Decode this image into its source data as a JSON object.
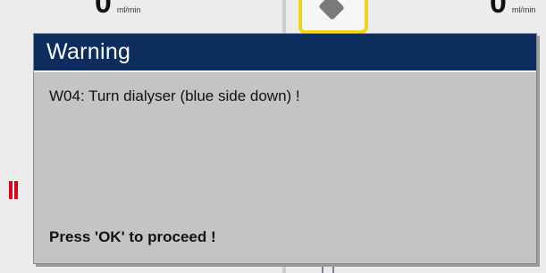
{
  "background": {
    "left_flow": {
      "value": "0",
      "unit": "ml/min"
    },
    "right_flow": {
      "value": "0",
      "unit": "ml/min"
    }
  },
  "dialog": {
    "title": "Warning",
    "message": "W04: Turn dialyser (blue side down) !",
    "instruction": "Press 'OK' to proceed !"
  },
  "colors": {
    "header_bg": "#0c2d5e",
    "dialog_bg": "#c4c4c4",
    "alarm_marker": "#e0001a",
    "symbol_outline": "#f2d21c"
  }
}
